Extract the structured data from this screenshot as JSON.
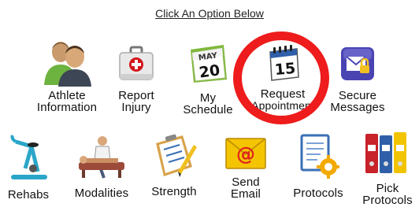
{
  "header": {
    "title": "Click An Option Below"
  },
  "row1": [
    {
      "key": "athlete",
      "line1": "Athlete",
      "line2": "Information"
    },
    {
      "key": "injury",
      "line1": "Report",
      "line2": "Injury"
    },
    {
      "key": "schedule",
      "line1": "My",
      "line2": "Schedule",
      "cal_month": "MAY",
      "cal_day": "20"
    },
    {
      "key": "appointment",
      "line1": "Request",
      "line2": "Appointment",
      "cal_day": "15"
    },
    {
      "key": "messages",
      "line1": "Secure",
      "line2": "Messages"
    }
  ],
  "row2": [
    {
      "key": "rehabs",
      "line1": "Rehabs"
    },
    {
      "key": "modalities",
      "line1": "Modalities"
    },
    {
      "key": "strength",
      "line1": "Strength"
    },
    {
      "key": "email",
      "line1": "Send",
      "line2": "Email"
    },
    {
      "key": "protocols",
      "line1": "Protocols"
    },
    {
      "key": "pick",
      "line1": "Pick",
      "line2": "Protocols"
    }
  ],
  "colors": {
    "highlight_ring": "#ee1c1c",
    "calendar_green": "#8cc63f",
    "email_gold": "#f5c400"
  }
}
